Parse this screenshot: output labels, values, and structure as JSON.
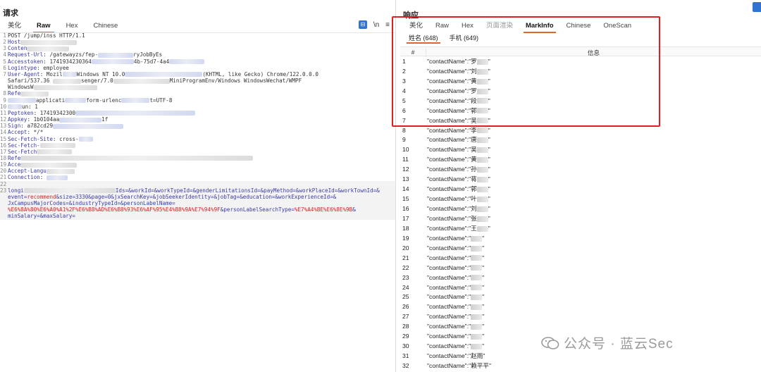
{
  "request": {
    "title": "请求",
    "tabs": [
      "美化",
      "Raw",
      "Hex",
      "Chinese"
    ],
    "active_tab": "Raw",
    "tools": [
      "\\n",
      "≡"
    ],
    "lines": [
      {
        "n": "1",
        "parts": [
          {
            "t": "POST /jump/inss HTTP/1.1",
            "c": "hv"
          }
        ]
      },
      {
        "n": "2",
        "parts": [
          {
            "t": "Host",
            "c": "hk"
          },
          {
            "b": 80
          }
        ]
      },
      {
        "n": "3",
        "parts": [
          {
            "t": "Conten",
            "c": "hk"
          },
          {
            "b": 60
          }
        ]
      },
      {
        "n": "4",
        "parts": [
          {
            "t": "Request-Url",
            "c": "hk"
          },
          {
            "t": ": /gatewayzs/fep-",
            "c": "hv"
          },
          {
            "b": 50
          },
          {
            "t": "ryJobByEs",
            "c": "hv"
          }
        ]
      },
      {
        "n": "5",
        "parts": [
          {
            "t": "Accesstoken",
            "c": "hk"
          },
          {
            "t": ": 1741934230364",
            "c": "hv"
          },
          {
            "b": 60
          },
          {
            "t": "4b-75d7-4a4",
            "c": "hv"
          },
          {
            "b": 50
          }
        ]
      },
      {
        "n": "6",
        "parts": [
          {
            "t": "Logintype",
            "c": "hk"
          },
          {
            "t": ": employee",
            "c": "hv"
          }
        ]
      },
      {
        "n": "7",
        "parts": [
          {
            "t": "User-Agent",
            "c": "hk"
          },
          {
            "t": ": Mozil",
            "c": "hv"
          },
          {
            "b": 20
          },
          {
            "t": "Windows NT 10.0",
            "c": "hv"
          },
          {
            "b": 110
          },
          {
            "t": "(KHTML, like Gecko) Chrome/122.0.0.0",
            "c": "hv"
          }
        ]
      },
      {
        "n": "",
        "parts": [
          {
            "t": "Safari/537.36 ",
            "c": "hv"
          },
          {
            "b": 40
          },
          {
            "t": "senger/7.0",
            "c": "hv"
          },
          {
            "b": 80
          },
          {
            "t": "MiniProgramEnv/Windows WindowsWechat/WMPF",
            "c": "hv"
          }
        ]
      },
      {
        "n": "",
        "parts": [
          {
            "t": "WindowsW",
            "c": "hv"
          },
          {
            "b": 90
          }
        ]
      },
      {
        "n": "8",
        "parts": [
          {
            "t": "Refe",
            "c": "hk"
          },
          {
            "b": 40
          }
        ]
      },
      {
        "n": "9",
        "parts": [
          {
            "b": 40
          },
          {
            "t": "applicati",
            "c": "hv"
          },
          {
            "b": 30
          },
          {
            "t": "form-urlenc",
            "c": "hv"
          },
          {
            "b": 40
          },
          {
            "t": "t=UTF-8",
            "c": "hv"
          }
        ]
      },
      {
        "n": "10",
        "parts": [
          {
            "b": 20
          },
          {
            "t": "un: 1",
            "c": "hv"
          }
        ]
      },
      {
        "n": "11",
        "parts": [
          {
            "t": "Peptoken",
            "c": "hk"
          },
          {
            "t": ": 17419342300",
            "c": "hv"
          },
          {
            "b": 170
          }
        ]
      },
      {
        "n": "12",
        "parts": [
          {
            "t": "Appkey",
            "c": "hk"
          },
          {
            "t": ": 1b0104aa",
            "c": "hv"
          },
          {
            "b": 60
          },
          {
            "t": "1f",
            "c": "hv"
          }
        ]
      },
      {
        "n": "13",
        "parts": [
          {
            "t": "Sign",
            "c": "hk"
          },
          {
            "t": ": a782cd29",
            "c": "hv"
          },
          {
            "b": 100
          }
        ]
      },
      {
        "n": "14",
        "parts": [
          {
            "t": "Accept",
            "c": "hk"
          },
          {
            "t": ": */*",
            "c": "hv"
          }
        ]
      },
      {
        "n": "15",
        "parts": [
          {
            "t": "Sec-Fetch-Site",
            "c": "hk"
          },
          {
            "t": ": cross-",
            "c": "hv"
          },
          {
            "b": 20
          }
        ]
      },
      {
        "n": "16",
        "parts": [
          {
            "t": "Sec-Fetch-",
            "c": "hk"
          },
          {
            "b": 50
          }
        ]
      },
      {
        "n": "17",
        "parts": [
          {
            "t": "Sec-Fetch",
            "c": "hk"
          },
          {
            "b": 50
          }
        ]
      },
      {
        "n": "18",
        "parts": [
          {
            "t": "Refe",
            "c": "hk"
          },
          {
            "b": 330
          }
        ]
      },
      {
        "n": "19",
        "parts": [
          {
            "t": "Acce",
            "c": "hk"
          },
          {
            "b": 80
          }
        ]
      },
      {
        "n": "20",
        "parts": [
          {
            "t": "Accept-Langu",
            "c": "hk"
          },
          {
            "b": 40
          }
        ]
      },
      {
        "n": "21",
        "parts": [
          {
            "t": "Connection",
            "c": "hk"
          },
          {
            "t": ": ",
            "c": "hv"
          },
          {
            "b": 30
          }
        ]
      },
      {
        "n": "22",
        "parts": []
      },
      {
        "n": "23",
        "parts": [
          {
            "t": "longi",
            "c": "hk"
          },
          {
            "b": 130
          },
          {
            "t": "Ids=&workId=&workTypeId=&genderLimitationsId=&payMethod=&workPlaceId=&workTownId=&",
            "c": "hk"
          }
        ]
      },
      {
        "n": "",
        "parts": [
          {
            "t": "event=",
            "c": "hk"
          },
          {
            "t": "recommend",
            "c": "red"
          },
          {
            "t": "&size=3330&page=0&jxSearchKey=&jobSeekerIdentity=&jobTag=&education=&workExperienceId=&",
            "c": "hk"
          }
        ]
      },
      {
        "n": "",
        "parts": [
          {
            "t": "JxCampusMajorCodes=&industryTypeId=&personLabelName=",
            "c": "hk"
          }
        ]
      },
      {
        "n": "",
        "parts": [
          {
            "t": "%E6%8A%80%E6%A0%A1%2F%E6%B8%AD%E6%B8%93%E6%AF%95%E4%B8%9A%E7%94%9F",
            "c": "red"
          },
          {
            "t": "&personLabelSearchType=",
            "c": "hk"
          },
          {
            "t": "%E7%A4%BE%E6%8E%9B",
            "c": "red"
          },
          {
            "t": "&",
            "c": "hk"
          }
        ]
      },
      {
        "n": "",
        "parts": [
          {
            "t": "minSalary=&maxSalary=",
            "c": "hk"
          }
        ]
      }
    ]
  },
  "response": {
    "title": "响应",
    "tabs": [
      "美化",
      "Raw",
      "Hex",
      "页面渲染",
      "MarkInfo",
      "Chinese",
      "OneScan"
    ],
    "active_tab": "MarkInfo",
    "subtabs": [
      "姓名 (648)",
      "手机 (649)"
    ],
    "active_subtab": "姓名 (648)",
    "table_headers": [
      "#",
      "信息"
    ],
    "rows": [
      {
        "n": "1",
        "pre": "\"contactName\":\"罗",
        "post": "\""
      },
      {
        "n": "2",
        "pre": "\"contactName\":\"刘",
        "post": "\""
      },
      {
        "n": "3",
        "pre": "\"contactName\":\"黄",
        "post": "\""
      },
      {
        "n": "4",
        "pre": "\"contactName\":\"罗",
        "post": "\""
      },
      {
        "n": "5",
        "pre": "\"contactName\":\"段",
        "post": "\""
      },
      {
        "n": "6",
        "pre": "\"contactName\":\"郭",
        "post": "\""
      },
      {
        "n": "7",
        "pre": "\"contactName\":\"吴",
        "post": "\""
      },
      {
        "n": "8",
        "pre": "\"contactName\":\"李",
        "post": "\""
      },
      {
        "n": "9",
        "pre": "\"contactName\":\"唐",
        "post": "\""
      },
      {
        "n": "10",
        "pre": "\"contactName\":\"吴",
        "post": "\""
      },
      {
        "n": "11",
        "pre": "\"contactName\":\"黄",
        "post": "\""
      },
      {
        "n": "12",
        "pre": "\"contactName\":\"孙",
        "post": "\""
      },
      {
        "n": "13",
        "pre": "\"contactName\":\"蒋",
        "post": "\""
      },
      {
        "n": "14",
        "pre": "\"contactName\":\"郭",
        "post": "\""
      },
      {
        "n": "15",
        "pre": "\"contactName\":\"叶",
        "post": "\""
      },
      {
        "n": "16",
        "pre": "\"contactName\":\"刘",
        "post": "\""
      },
      {
        "n": "17",
        "pre": "\"contactName\":\"张",
        "post": "\""
      },
      {
        "n": "18",
        "pre": "\"contactName\":\"王",
        "post": "\""
      },
      {
        "n": "19",
        "pre": "\"contactName\":\"",
        "post": "\""
      },
      {
        "n": "20",
        "pre": "\"contactName\":\"",
        "post": "\""
      },
      {
        "n": "21",
        "pre": "\"contactName\":\"",
        "post": "\""
      },
      {
        "n": "22",
        "pre": "\"contactName\":\"",
        "post": "\""
      },
      {
        "n": "23",
        "pre": "\"contactName\":\"",
        "post": "\""
      },
      {
        "n": "24",
        "pre": "\"contactName\":\"",
        "post": "\""
      },
      {
        "n": "25",
        "pre": "\"contactName\":\"",
        "post": "\""
      },
      {
        "n": "26",
        "pre": "\"contactName\":\"",
        "post": "\""
      },
      {
        "n": "27",
        "pre": "\"contactName\":\"",
        "post": "\""
      },
      {
        "n": "28",
        "pre": "\"contactName\":\"",
        "post": "\""
      },
      {
        "n": "29",
        "pre": "\"contactName\":\"",
        "post": "\""
      },
      {
        "n": "30",
        "pre": "\"contactName\":\"",
        "post": "\""
      },
      {
        "n": "31",
        "pre": "\"contactName\":\"赵雨\"",
        "post": ""
      },
      {
        "n": "32",
        "pre": "\"contactName\":\"赖平平\"",
        "post": ""
      }
    ]
  },
  "watermark": {
    "text": "公众号 · 蓝云Sec"
  },
  "colors": {
    "accent": "#e0662d",
    "highlight_box": "#e02020",
    "tool_blue": "#2f74d0"
  }
}
